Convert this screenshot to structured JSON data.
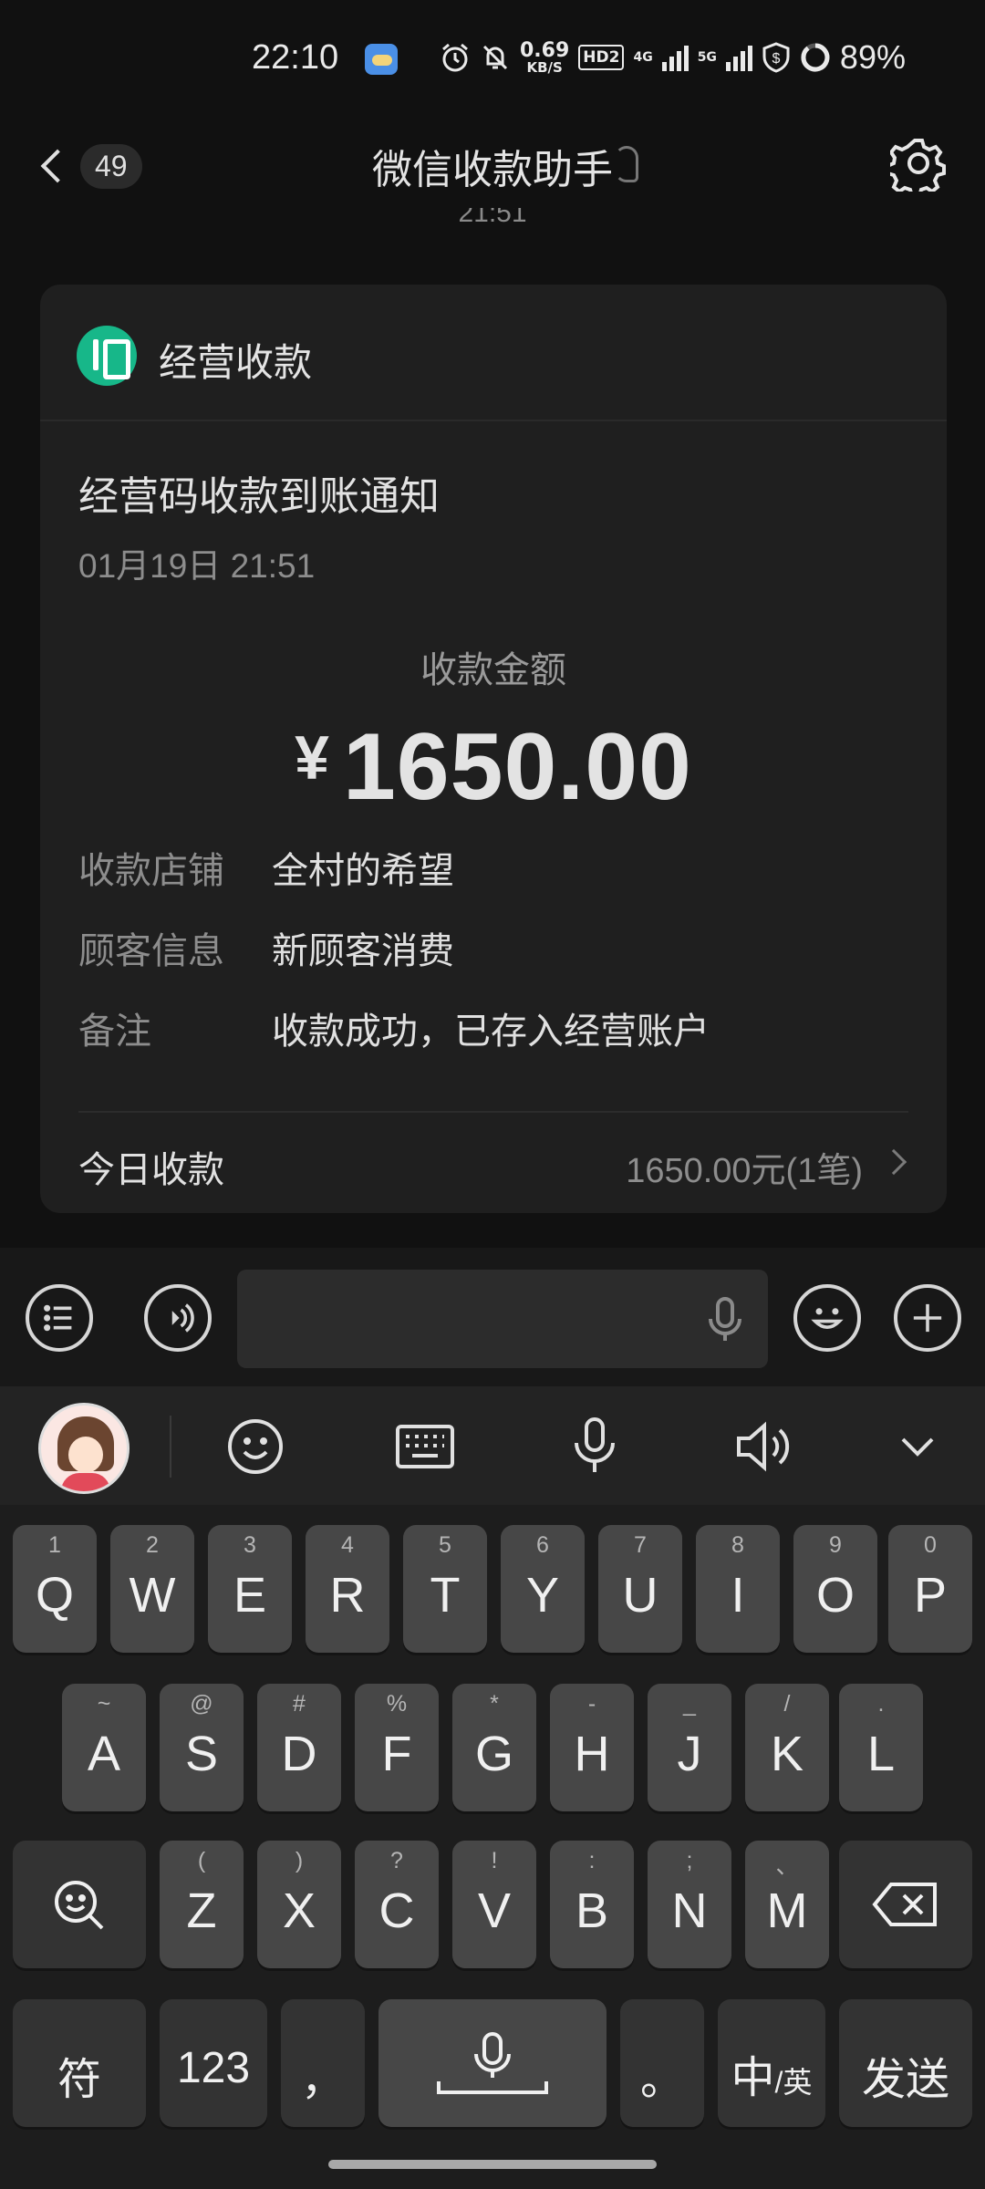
{
  "status_bar": {
    "time": "22:10",
    "net_speed_value": "0.69",
    "net_speed_unit": "KB/S",
    "hd_label": "HD2",
    "network_1": "4G",
    "network_2": "5G",
    "battery": "89%",
    "icons": [
      "weather-icon",
      "alarm-icon",
      "mute-icon",
      "signal-icon",
      "shield-icon",
      "battery-icon"
    ]
  },
  "header": {
    "unread_count": "49",
    "title": "微信收款助手",
    "peek_time": "21:51"
  },
  "card": {
    "merchant": "经营收款",
    "notice_title": "经营码收款到账通知",
    "notice_time": "01月19日 21:51",
    "amount_label": "收款金额",
    "currency": "¥",
    "amount": "1650.00",
    "rows": [
      {
        "key": "收款店铺",
        "value": "全村的希望"
      },
      {
        "key": "顾客信息",
        "value": "新顾客消费"
      },
      {
        "key": "备注",
        "value": "收款成功，已存入经营账户"
      }
    ],
    "today_label": "今日收款",
    "today_value": "1650.00元(1笔)"
  },
  "input_bar": {
    "text_value": "",
    "icons": [
      "list-icon",
      "voice-mode-icon",
      "mic-icon",
      "emoji-icon",
      "plus-icon"
    ]
  },
  "keyboard": {
    "row1": [
      {
        "main": "Q",
        "sub": "1"
      },
      {
        "main": "W",
        "sub": "2"
      },
      {
        "main": "E",
        "sub": "3"
      },
      {
        "main": "R",
        "sub": "4"
      },
      {
        "main": "T",
        "sub": "5"
      },
      {
        "main": "Y",
        "sub": "6"
      },
      {
        "main": "U",
        "sub": "7"
      },
      {
        "main": "I",
        "sub": "8"
      },
      {
        "main": "O",
        "sub": "9"
      },
      {
        "main": "P",
        "sub": "0"
      }
    ],
    "row2": [
      {
        "main": "A",
        "sub": "~"
      },
      {
        "main": "S",
        "sub": "@"
      },
      {
        "main": "D",
        "sub": "#"
      },
      {
        "main": "F",
        "sub": "%"
      },
      {
        "main": "G",
        "sub": "*"
      },
      {
        "main": "H",
        "sub": "-"
      },
      {
        "main": "J",
        "sub": "_"
      },
      {
        "main": "K",
        "sub": "/"
      },
      {
        "main": "L",
        "sub": "."
      }
    ],
    "row3": [
      {
        "main": "Z",
        "sub": "("
      },
      {
        "main": "X",
        "sub": ")"
      },
      {
        "main": "C",
        "sub": "?"
      },
      {
        "main": "V",
        "sub": "!"
      },
      {
        "main": "B",
        "sub": ":"
      },
      {
        "main": "N",
        "sub": ";"
      },
      {
        "main": "M",
        "sub": "、"
      }
    ],
    "symbol_key": "符",
    "number_key": "123",
    "comma_key": "，",
    "period_key": "。",
    "lang_key_main": "中",
    "lang_key_alt": "/英",
    "send_key": "发送"
  }
}
